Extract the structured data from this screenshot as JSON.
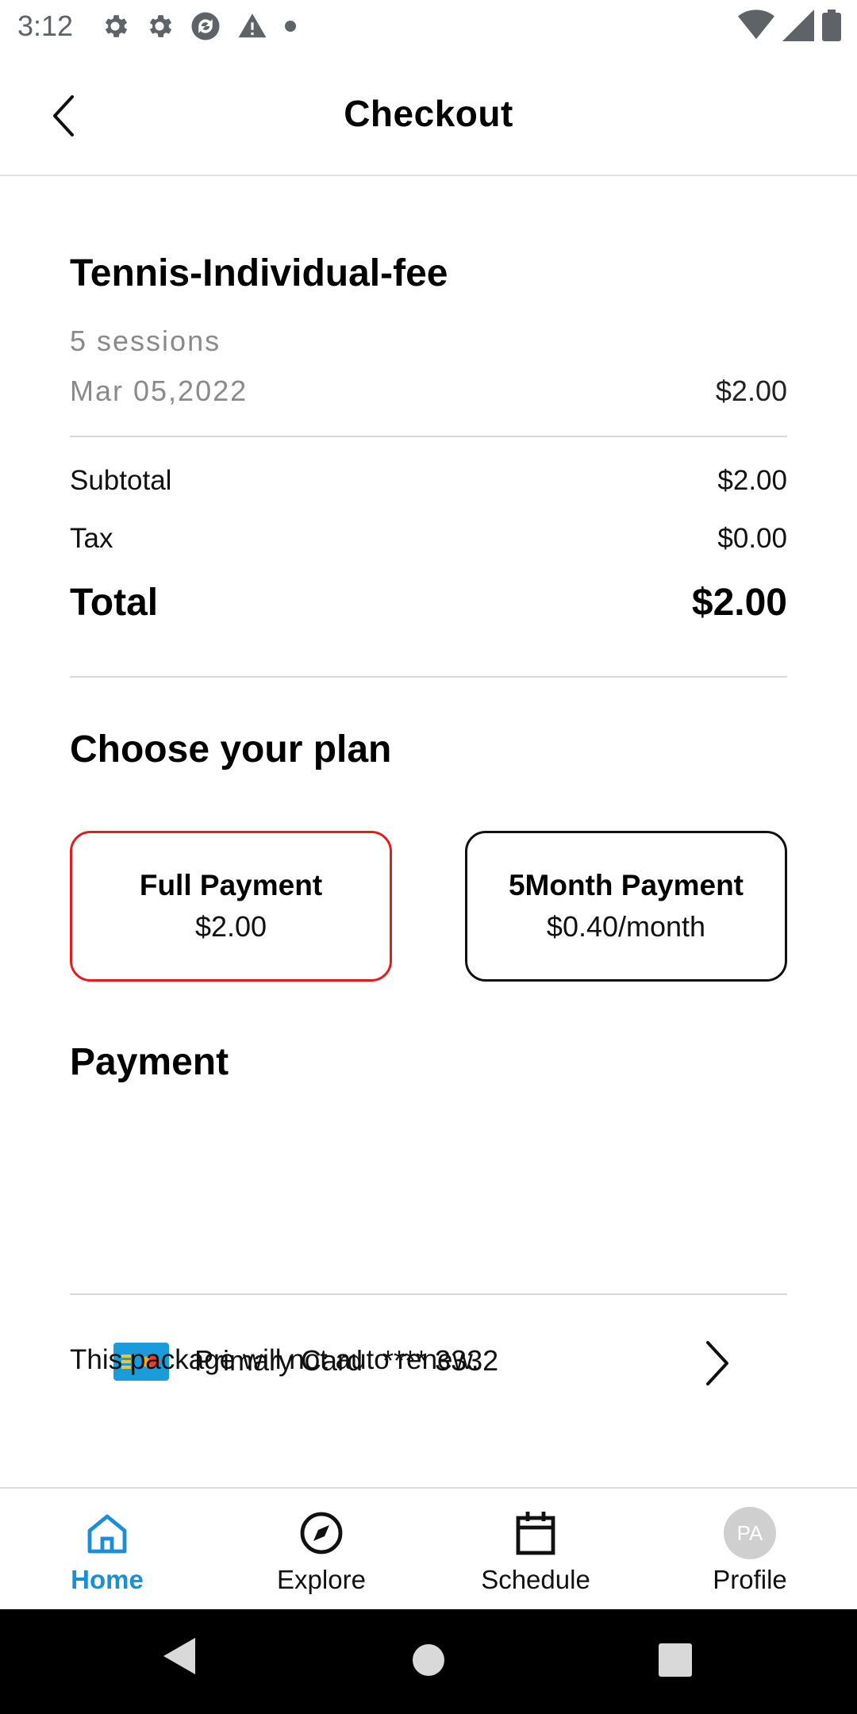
{
  "status_bar": {
    "time": "3:12",
    "left_icons": [
      "gear-icon",
      "gear-icon",
      "sync-icon",
      "warning-icon",
      "dot-icon"
    ],
    "right_icons": [
      "wifi-icon",
      "signal-icon",
      "battery-icon"
    ]
  },
  "header": {
    "title": "Checkout"
  },
  "item": {
    "name": "Tennis-Individual-fee",
    "sessions": "5 sessions",
    "date": "Mar 05,2022",
    "price": "$2.00"
  },
  "summary": {
    "subtotal_label": "Subtotal",
    "subtotal_value": "$2.00",
    "tax_label": "Tax",
    "tax_value": "$0.00",
    "total_label": "Total",
    "total_value": "$2.00"
  },
  "plans": {
    "heading": "Choose your plan",
    "options": [
      {
        "name": "Full Payment",
        "price": "$2.00",
        "selected": true
      },
      {
        "name": "5Month Payment",
        "price": "$0.40/month",
        "selected": false
      }
    ]
  },
  "payment": {
    "heading": "Payment",
    "card_label": "Primary Card",
    "card_number": "**** 3332"
  },
  "renew_note": "This package will not auto renew.",
  "bottom_nav": {
    "items": [
      {
        "label": "Home",
        "icon": "home-icon",
        "active": true
      },
      {
        "label": "Explore",
        "icon": "compass-icon",
        "active": false
      },
      {
        "label": "Schedule",
        "icon": "calendar-icon",
        "active": false
      },
      {
        "label": "Profile",
        "icon": "avatar",
        "active": false,
        "avatar_initials": "PA"
      }
    ]
  },
  "colors": {
    "accent": "#1a8fd6",
    "selected_border": "#e11d1d",
    "muted_text": "#8a8a8a"
  }
}
